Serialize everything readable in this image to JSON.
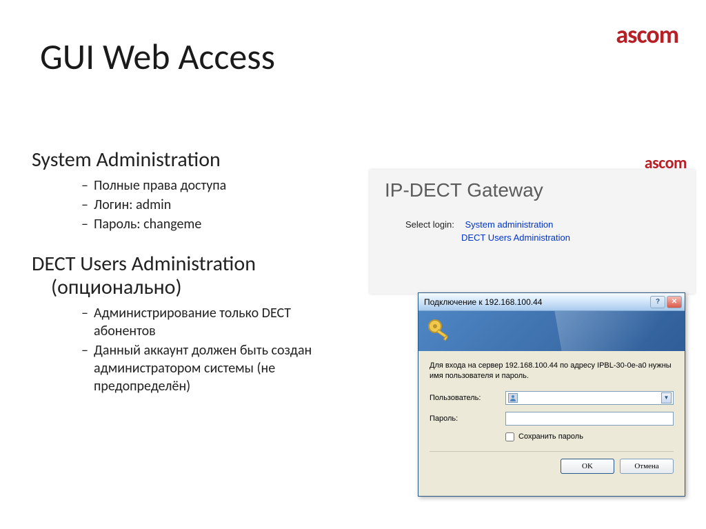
{
  "slide": {
    "title": "GUI Web Access",
    "logo": "ascom"
  },
  "left": {
    "sec1_head": "System Administration",
    "sec1_items": [
      "Полные права доступа",
      "Логин: admin",
      "Пароль: changeme"
    ],
    "sec2_head_l1": "DECT Users Administration",
    "sec2_head_l2": "(опционально)",
    "sec2_items": [
      "Администрирование только DECT абонентов",
      "Данный аккаунт должен быть создан администратором системы  (не предопределён)"
    ]
  },
  "web": {
    "logo": "ascom",
    "title": "IP-DECT Gateway",
    "select_label": "Select login:",
    "link1": "System administration",
    "link2": "DECT Users Administration"
  },
  "dlg": {
    "title": "Подключение к 192.168.100.44",
    "help": "?",
    "close": "✕",
    "message": "Для входа на сервер 192.168.100.44 по адресу IPBL-30-0e-a0 нужны имя пользователя и пароль.",
    "user_label": "Пользователь:",
    "user_value": "",
    "pass_label": "Пароль:",
    "save_label": "Сохранить пароль",
    "ok": "OK",
    "cancel": "Отмена"
  }
}
